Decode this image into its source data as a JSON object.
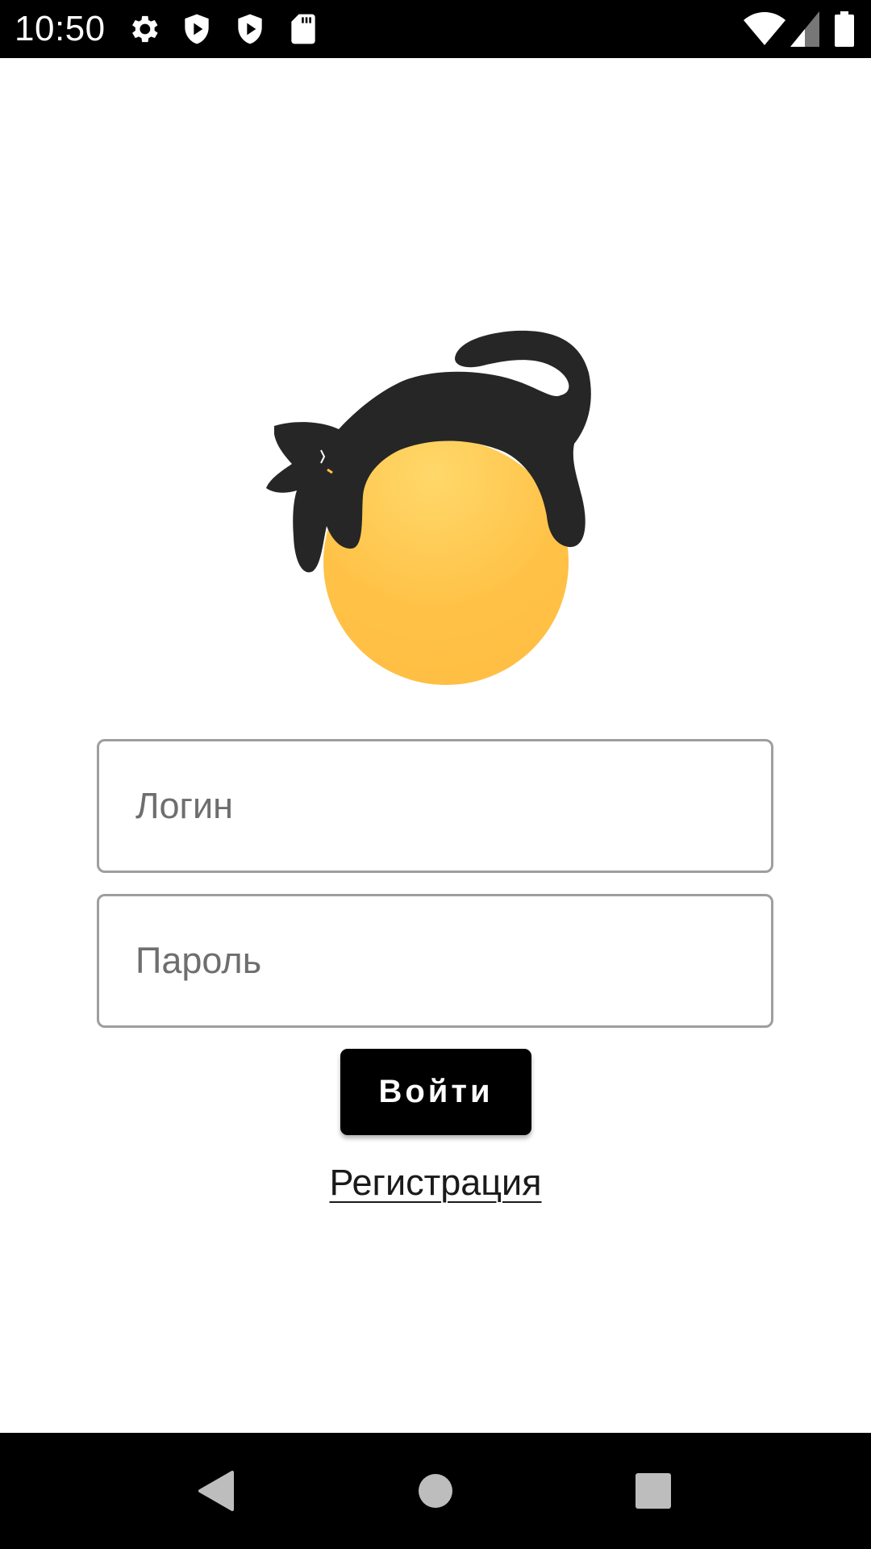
{
  "status_bar": {
    "time": "10:50",
    "left_icons": [
      "settings-icon",
      "shield-play-icon",
      "shield-play-icon",
      "sd-card-icon"
    ],
    "right_icons": [
      "wifi-icon",
      "signal-icon",
      "battery-icon"
    ]
  },
  "logo": {
    "name": "cat-on-ball-logo",
    "ball_color": "#FFC247",
    "cat_color": "#262626"
  },
  "form": {
    "login_placeholder": "Логин",
    "login_value": "",
    "password_placeholder": "Пароль",
    "password_value": "",
    "submit_label": "Войти",
    "register_label": "Регистрация"
  },
  "nav_bar": {
    "buttons": [
      "back-icon",
      "home-icon",
      "recents-icon"
    ]
  },
  "colors": {
    "status_bar": "#000000",
    "nav_bar": "#000000",
    "button_bg": "#000000",
    "field_border": "#9E9E9E"
  }
}
